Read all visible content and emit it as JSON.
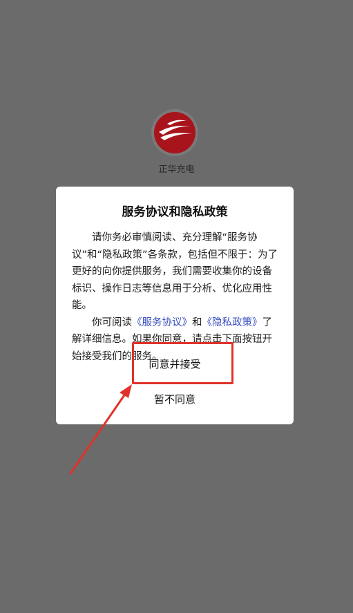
{
  "app": {
    "name": "正华充电",
    "logo_icon": "brand-swoosh-logo",
    "brand_color": "#a8141c"
  },
  "dialog": {
    "title": "服务协议和隐私政策",
    "paragraph1": "请你务必审慎阅读、充分理解“服务协议”和“隐私政策”各条款，包括但不限于：为了更好的向你提供服务，我们需要收集你的设备标识、操作日志等信息用于分析、优化应用性能。",
    "p2_prefix": "你可阅读",
    "service_link": "《服务协议》",
    "p2_and": "和",
    "privacy_link": "《隐私政策》",
    "p2_suffix": "了解详细信息。如果你同意，请点击下面按钮开始接受我们的服务。",
    "agree_label": "同意并接受",
    "decline_label": "暂不同意"
  },
  "annotation": {
    "color": "#e0322a"
  }
}
